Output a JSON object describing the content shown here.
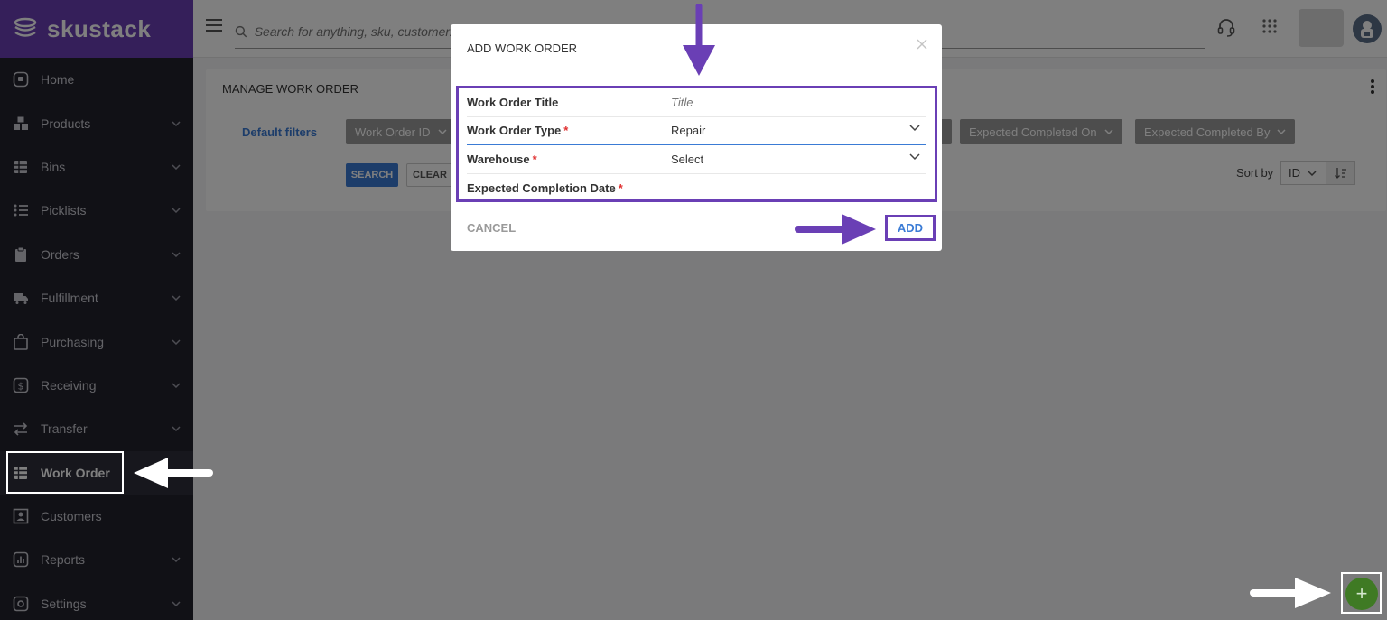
{
  "brand": {
    "name": "skustack"
  },
  "search": {
    "placeholder": "Search for anything, sku, customer..."
  },
  "sidebar": {
    "items": [
      {
        "label": "Home",
        "icon": "home-icon"
      },
      {
        "label": "Products",
        "icon": "products-icon"
      },
      {
        "label": "Bins",
        "icon": "bins-icon"
      },
      {
        "label": "Picklists",
        "icon": "list-icon"
      },
      {
        "label": "Orders",
        "icon": "clipboard-icon"
      },
      {
        "label": "Fulfillment",
        "icon": "truck-icon"
      },
      {
        "label": "Purchasing",
        "icon": "bag-icon"
      },
      {
        "label": "Receiving",
        "icon": "dollar-icon"
      },
      {
        "label": "Transfer",
        "icon": "transfer-icon"
      },
      {
        "label": "Work Order",
        "icon": "table-icon",
        "active": true
      },
      {
        "label": "Customers",
        "icon": "contact-icon"
      },
      {
        "label": "Reports",
        "icon": "chart-icon"
      },
      {
        "label": "Settings",
        "icon": "gear-icon"
      }
    ]
  },
  "page": {
    "title": "MANAGE WORK ORDER",
    "default_filters": "Default filters",
    "filters": {
      "work_order_id": "Work Order ID",
      "expected_completed_on": "Expected Completed On",
      "expected_completed_by": "Expected Completed By"
    },
    "search_button": "SEARCH",
    "clear_button": "CLEAR",
    "sort_by_label": "Sort by",
    "sort_value": "ID"
  },
  "modal": {
    "title": "ADD WORK ORDER",
    "fields": {
      "title": {
        "label": "Work Order Title",
        "placeholder": "Title"
      },
      "type": {
        "label": "Work Order Type",
        "value": "Repair"
      },
      "warehouse": {
        "label": "Warehouse",
        "value": "Select"
      },
      "date": {
        "label": "Expected Completion Date"
      }
    },
    "required_mark": "*",
    "cancel": "CANCEL",
    "add": "ADD"
  },
  "fab": {
    "label": "+"
  },
  "colors": {
    "brand": "#6a3fb5",
    "accent": "#3a7bd5",
    "sidebar": "#23232d",
    "fab": "#3f7a24",
    "required": "#e03030"
  }
}
